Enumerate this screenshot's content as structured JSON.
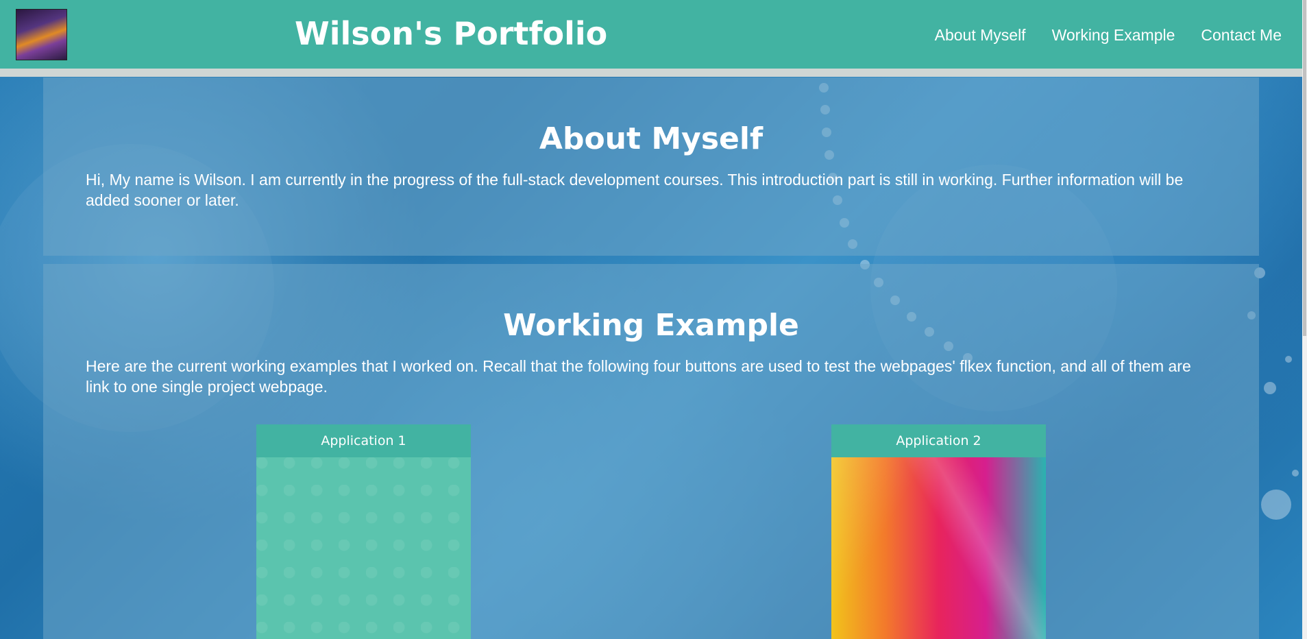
{
  "header": {
    "title": "Wilson's Portfolio",
    "avatar_icon": "avatar-image",
    "nav": [
      {
        "label": "About Myself"
      },
      {
        "label": "Working Example"
      },
      {
        "label": "Contact Me"
      }
    ]
  },
  "about": {
    "heading": "About Myself",
    "body": "Hi, My name is Wilson. I am currently in the progress of the full-stack development courses. This introduction part is still in working. Further information will be added sooner or later."
  },
  "work": {
    "heading": "Working Example",
    "body": "Here are the current working examples that I worked on. Recall that the following four buttons are used to test the webpages' flkex function, and all of them are link to one single project webpage.",
    "cards": [
      {
        "label": "Application 1"
      },
      {
        "label": "Application 2"
      }
    ]
  },
  "colors": {
    "header_bg": "#42b3a2",
    "divider": "#cfd6d4",
    "card_header": "#42b3a2"
  }
}
